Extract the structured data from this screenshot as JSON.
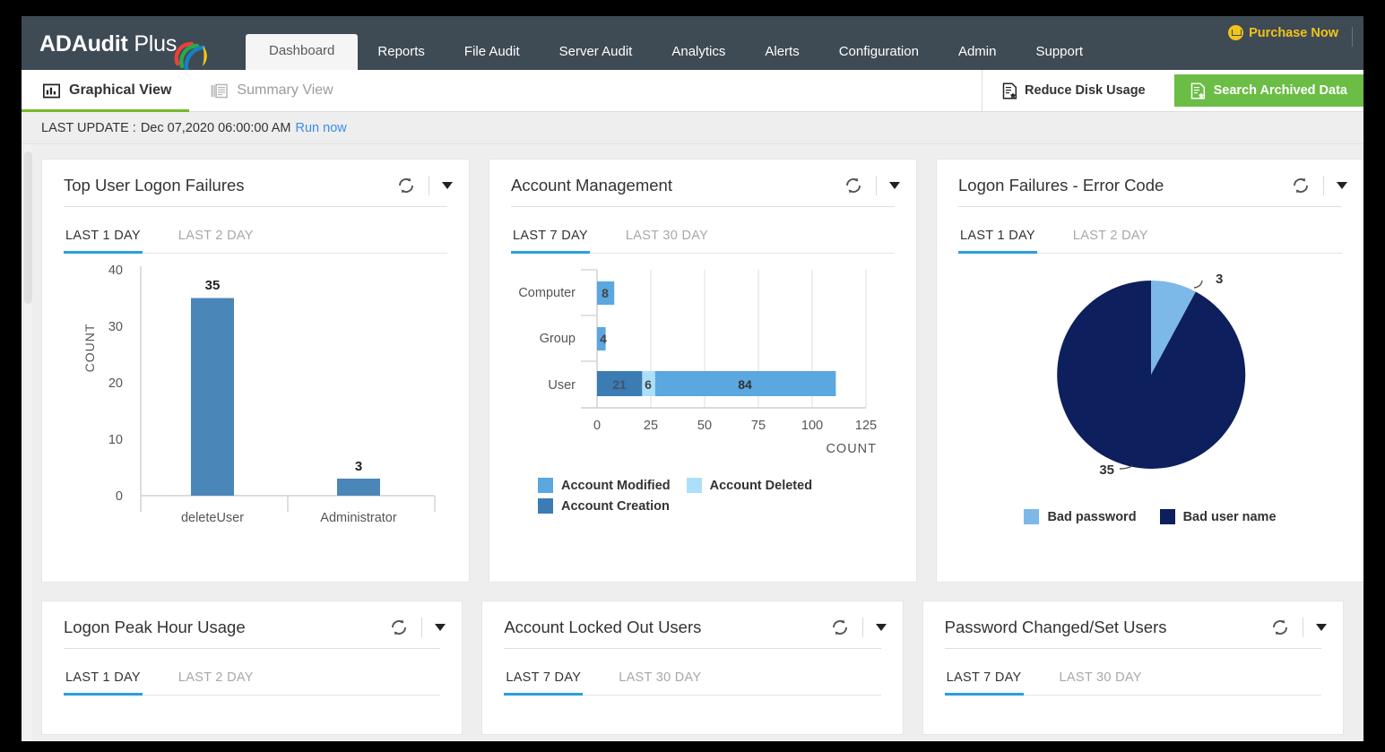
{
  "app": {
    "logo_bold": "ADAudit",
    "logo_light": " Plus",
    "purchase_label": "Purchase Now"
  },
  "mainnav": {
    "items": [
      {
        "label": "Dashboard",
        "active": true
      },
      {
        "label": "Reports",
        "active": false
      },
      {
        "label": "File Audit",
        "active": false
      },
      {
        "label": "Server Audit",
        "active": false
      },
      {
        "label": "Analytics",
        "active": false
      },
      {
        "label": "Alerts",
        "active": false
      },
      {
        "label": "Configuration",
        "active": false
      },
      {
        "label": "Admin",
        "active": false
      },
      {
        "label": "Support",
        "active": false
      }
    ]
  },
  "viewbar": {
    "graphical_label": "Graphical View",
    "summary_label": "Summary View",
    "reduce_disk_label": "Reduce Disk Usage",
    "search_archived_label": "Search Archived Data"
  },
  "lastupdate": {
    "prefix": "LAST UPDATE : ",
    "timestamp": "Dec 07,2020 06:00:00 AM",
    "run_now": "Run now"
  },
  "colors": {
    "nav_bg": "#3e4a54",
    "accent_green": "#76b82a",
    "accent_blue": "#2a9fe0",
    "purchase_yellow": "#f0c419",
    "bar_steel": "#4a86b8",
    "acct_modified": "#5ba7e0",
    "acct_deleted": "#ace0fa",
    "acct_creation": "#3b7cb5",
    "pie_bad_password": "#7cb8e8",
    "pie_bad_username": "#0d1f5c"
  },
  "cards": [
    {
      "title": "Top User Logon Failures",
      "tabs": [
        {
          "label": "LAST 1 DAY",
          "active": true
        },
        {
          "label": "LAST 2 DAY",
          "active": false
        }
      ]
    },
    {
      "title": "Account Management",
      "tabs": [
        {
          "label": "LAST 7 DAY",
          "active": true
        },
        {
          "label": "LAST 30 DAY",
          "active": false
        }
      ]
    },
    {
      "title": "Logon Failures - Error Code",
      "tabs": [
        {
          "label": "LAST 1 DAY",
          "active": true
        },
        {
          "label": "LAST 2 DAY",
          "active": false
        }
      ]
    },
    {
      "title": "Logon Peak Hour Usage",
      "tabs": [
        {
          "label": "LAST 1 DAY",
          "active": true
        },
        {
          "label": "LAST 2 DAY",
          "active": false
        }
      ]
    },
    {
      "title": "Account Locked Out Users",
      "tabs": [
        {
          "label": "LAST 7 DAY",
          "active": true
        },
        {
          "label": "LAST 30 DAY",
          "active": false
        }
      ]
    },
    {
      "title": "Password Changed/Set Users",
      "tabs": [
        {
          "label": "LAST 7 DAY",
          "active": true
        },
        {
          "label": "LAST 30 DAY",
          "active": false
        }
      ]
    }
  ],
  "chart_data": [
    {
      "type": "bar",
      "title": "Top User Logon Failures",
      "categories": [
        "deleteUser",
        "Administrator"
      ],
      "values": [
        35,
        3
      ],
      "data_labels": [
        "35",
        "3"
      ],
      "xlabel": "",
      "ylabel": "COUNT",
      "ylim": [
        0,
        40
      ],
      "yticks": [
        0,
        10,
        20,
        30,
        40
      ],
      "ytick_labels": [
        "0",
        "10",
        "20",
        "30",
        "40"
      ],
      "grid": false,
      "legend": null,
      "color": "#4a86b8"
    },
    {
      "type": "bar",
      "orientation": "horizontal",
      "stacked": true,
      "title": "Account Management",
      "categories": [
        "Computer",
        "Group",
        "User"
      ],
      "series": [
        {
          "name": "Account Creation",
          "color": "#3b7cb5",
          "values": [
            0,
            0,
            21
          ]
        },
        {
          "name": "Account Deleted",
          "color": "#ace0fa",
          "values": [
            0,
            0,
            6
          ]
        },
        {
          "name": "Account Modified",
          "color": "#5ba7e0",
          "values": [
            8,
            4,
            84
          ]
        }
      ],
      "bar_labels": {
        "Computer": [
          "8"
        ],
        "Group": [
          "4"
        ],
        "User": [
          "21",
          "6",
          "84"
        ]
      },
      "xlabel": "COUNT",
      "ylabel": "",
      "xlim": [
        0,
        125
      ],
      "xticks": [
        0,
        25,
        50,
        75,
        100,
        125
      ],
      "xtick_labels": [
        "0",
        "25",
        "50",
        "75",
        "100",
        "125"
      ],
      "grid": true,
      "legend": [
        "Account Modified",
        "Account Deleted",
        "Account Creation"
      ],
      "legend_position": "bottom"
    },
    {
      "type": "pie",
      "title": "Logon Failures - Error Code",
      "labels": [
        "Bad password",
        "Bad user name"
      ],
      "values": [
        3,
        35
      ],
      "data_labels": [
        "3",
        "35"
      ],
      "colors": [
        "#7cb8e8",
        "#0d1f5c"
      ],
      "legend": [
        "Bad password",
        "Bad user name"
      ],
      "legend_position": "bottom"
    }
  ]
}
